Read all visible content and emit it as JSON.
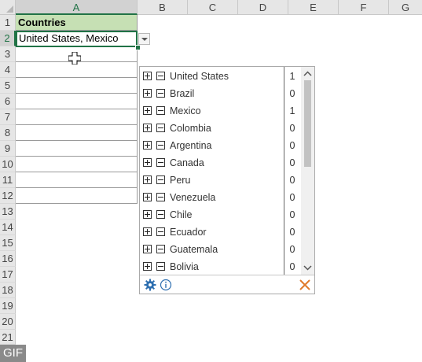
{
  "columns": [
    "A",
    "B",
    "C",
    "D",
    "E",
    "F",
    "G"
  ],
  "rows": [
    "1",
    "2",
    "3",
    "4",
    "5",
    "6",
    "7",
    "8",
    "9",
    "10",
    "11",
    "12",
    "13",
    "14",
    "15",
    "16",
    "17",
    "18",
    "19",
    "20",
    "21"
  ],
  "cells": {
    "a1": "Countries",
    "a2": "United States, Mexico"
  },
  "badge": "GIF",
  "popup": {
    "items": [
      {
        "label": "United States",
        "count": "1"
      },
      {
        "label": "Brazil",
        "count": "0"
      },
      {
        "label": "Mexico",
        "count": "1"
      },
      {
        "label": "Colombia",
        "count": "0"
      },
      {
        "label": "Argentina",
        "count": "0"
      },
      {
        "label": "Canada",
        "count": "0"
      },
      {
        "label": "Peru",
        "count": "0"
      },
      {
        "label": "Venezuela",
        "count": "0"
      },
      {
        "label": "Chile",
        "count": "0"
      },
      {
        "label": "Ecuador",
        "count": "0"
      },
      {
        "label": "Guatemala",
        "count": "0"
      },
      {
        "label": "Bolivia",
        "count": "0"
      }
    ],
    "icons": {
      "settings": "gear-icon",
      "info": "info-icon",
      "close": "close-icon"
    }
  },
  "colors": {
    "header_fill": "#c6e0b4",
    "selection": "#217346",
    "settings_icon": "#2e6fb0",
    "close_icon": "#e07a2a"
  }
}
